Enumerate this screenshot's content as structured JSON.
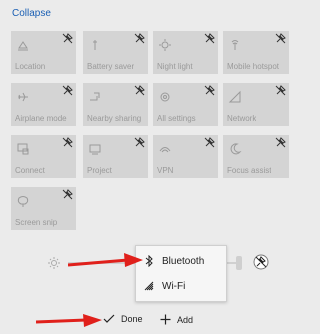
{
  "header": {
    "collapse_label": "Collapse"
  },
  "tiles": [
    {
      "label": "Location",
      "icon": "location-icon"
    },
    {
      "label": "Battery saver",
      "icon": "battery-saver-icon"
    },
    {
      "label": "Night light",
      "icon": "night-light-icon"
    },
    {
      "label": "Mobile hotspot",
      "icon": "mobile-hotspot-icon"
    },
    {
      "label": "Airplane mode",
      "icon": "airplane-icon"
    },
    {
      "label": "Nearby sharing",
      "icon": "nearby-sharing-icon"
    },
    {
      "label": "All settings",
      "icon": "gear-icon"
    },
    {
      "label": "Network",
      "icon": "network-icon"
    },
    {
      "label": "Connect",
      "icon": "connect-icon"
    },
    {
      "label": "Project",
      "icon": "project-icon"
    },
    {
      "label": "VPN",
      "icon": "vpn-icon"
    },
    {
      "label": "Focus assist",
      "icon": "moon-icon"
    },
    {
      "label": "Screen snip",
      "icon": "screen-snip-icon"
    }
  ],
  "popup": {
    "items": [
      {
        "label": "Bluetooth",
        "icon": "bluetooth-icon"
      },
      {
        "label": "Wi-Fi",
        "icon": "wifi-icon"
      }
    ]
  },
  "footer": {
    "done_label": "Done",
    "add_label": "Add"
  },
  "colors": {
    "accent": "#1a5fb4",
    "arrow": "#e0201b"
  }
}
